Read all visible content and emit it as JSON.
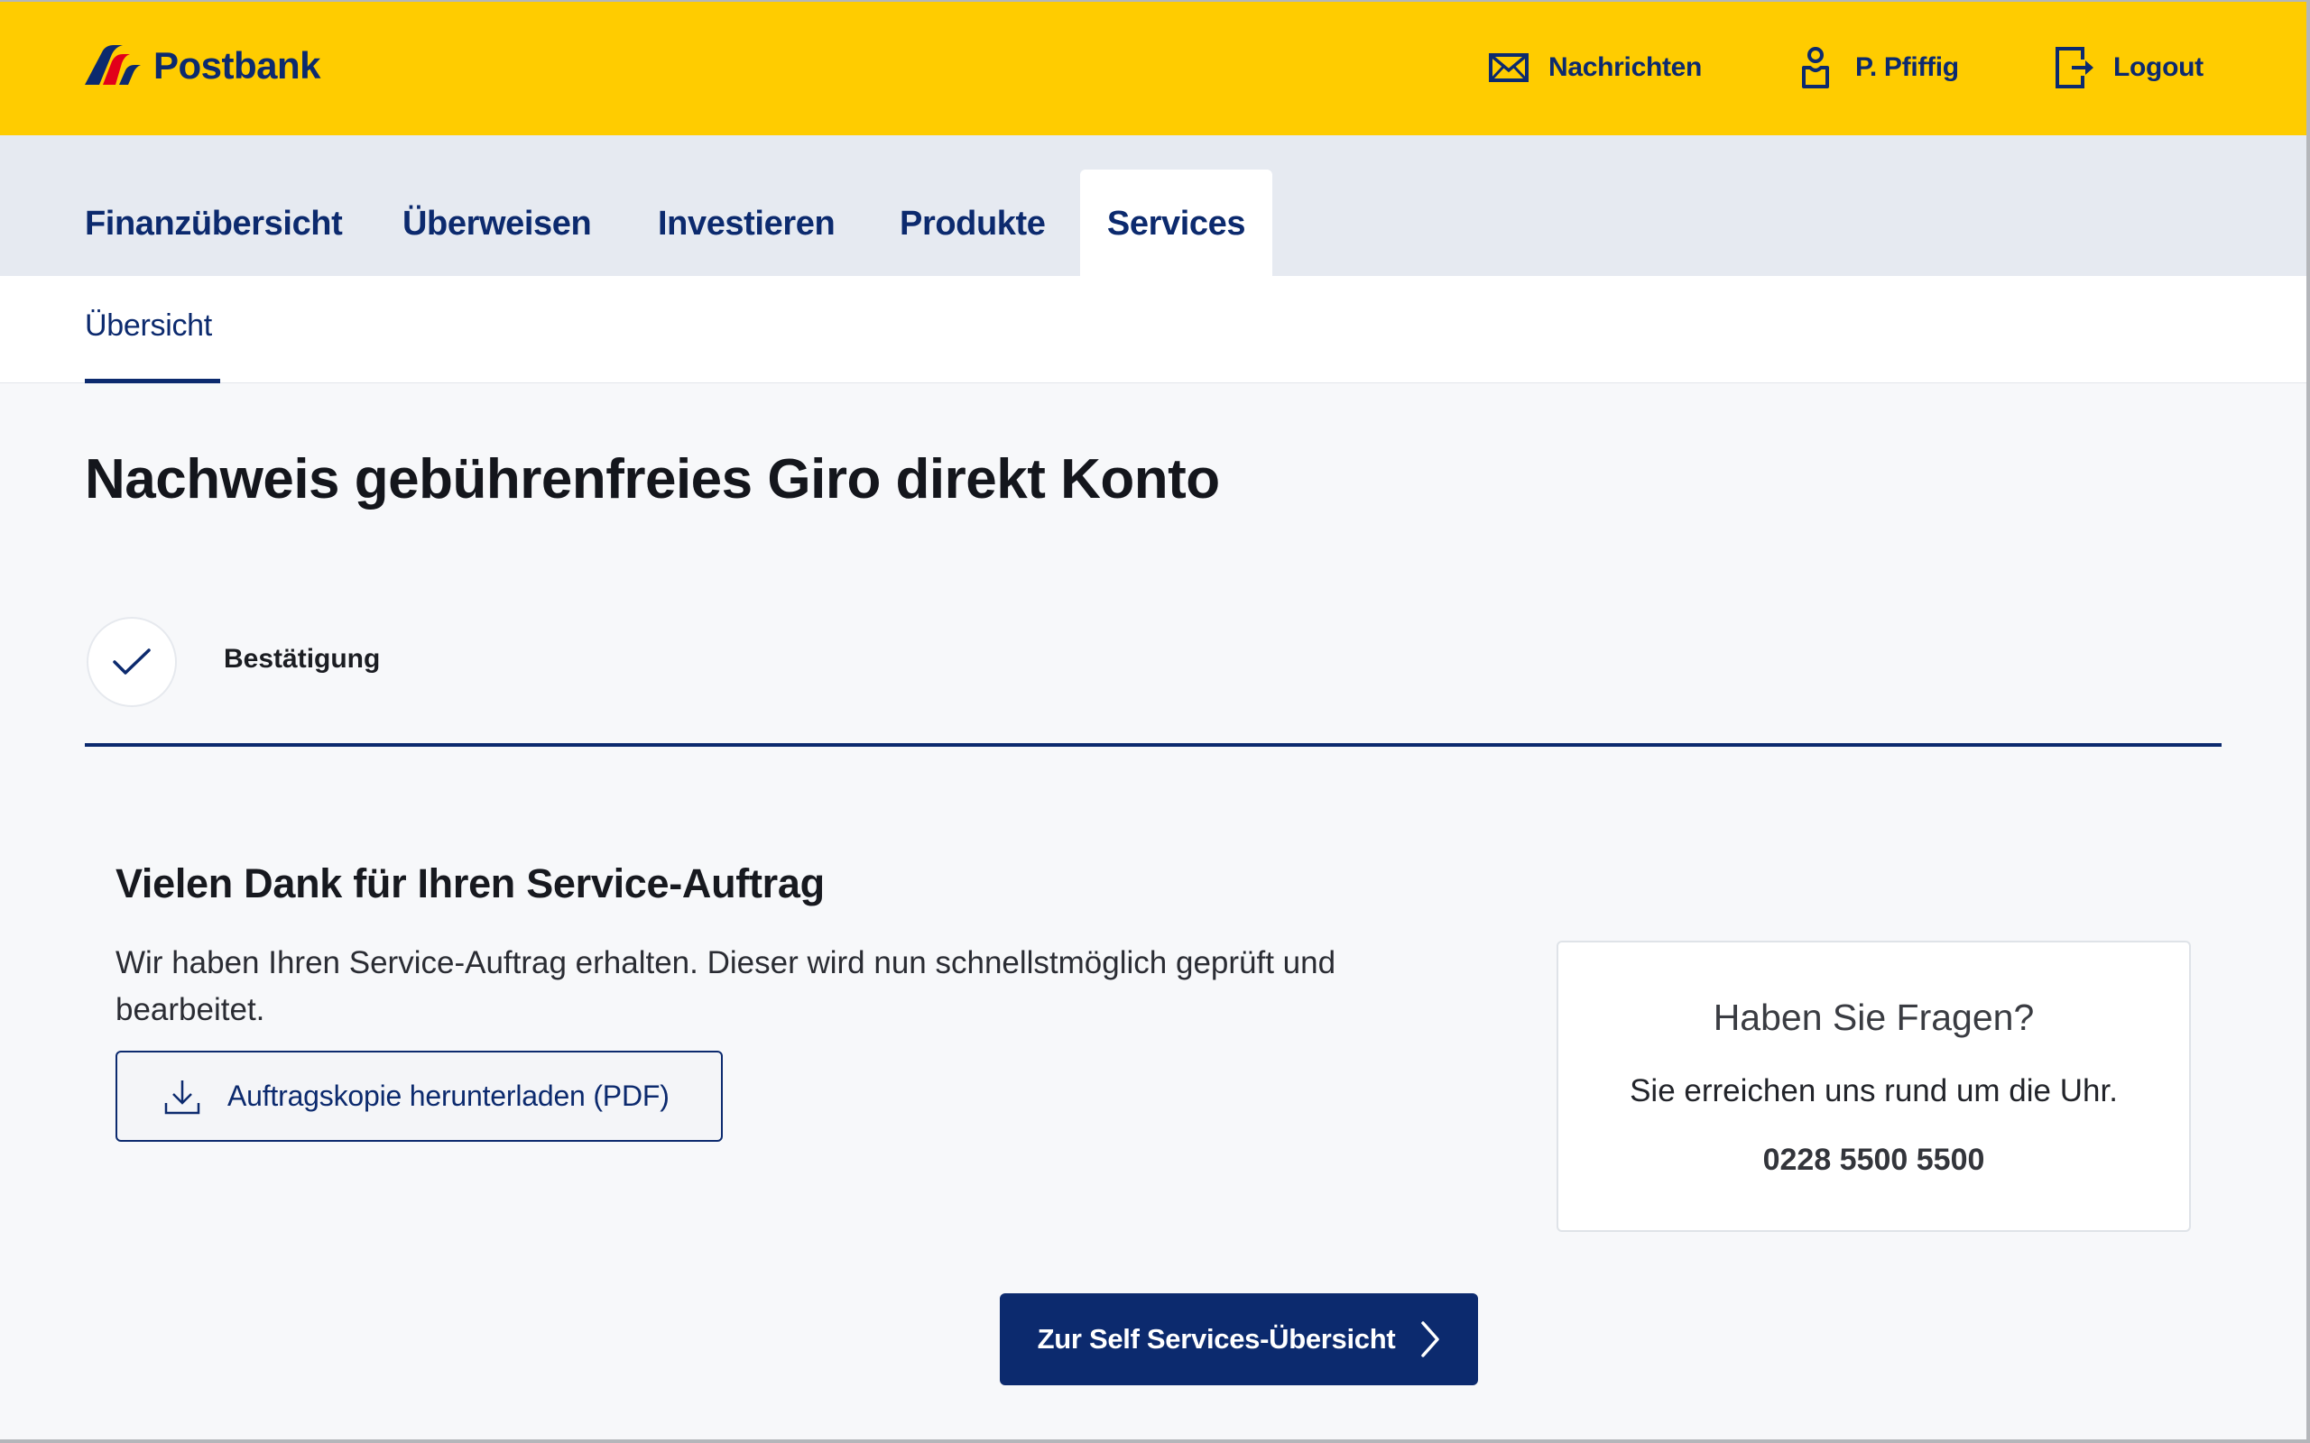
{
  "colors": {
    "brand_yellow": "#ffcc00",
    "brand_blue": "#0c2a6e",
    "logo_red": "#e2001a",
    "nav_background": "#e6eaf1",
    "page_background": "#f7f8fa"
  },
  "header": {
    "logo_text": "Postbank",
    "links": [
      {
        "label": "Nachrichten",
        "icon": "envelope-icon"
      },
      {
        "label": "P. Pfiffig",
        "icon": "user-icon"
      },
      {
        "label": "Logout",
        "icon": "logout-icon"
      }
    ]
  },
  "main_nav": {
    "tabs": [
      {
        "label": "Finanzübersicht",
        "active": false
      },
      {
        "label": "Überweisen",
        "active": false
      },
      {
        "label": "Investieren",
        "active": false
      },
      {
        "label": "Produkte",
        "active": false
      },
      {
        "label": "Services",
        "active": true
      }
    ]
  },
  "sub_nav": {
    "tabs": [
      {
        "label": "Übersicht",
        "active": true
      }
    ]
  },
  "page": {
    "title": "Nachweis gebührenfreies Giro direkt Konto",
    "step": {
      "label": "Bestätigung",
      "icon": "checkmark-icon",
      "completed": true
    }
  },
  "confirmation": {
    "title": "Vielen Dank für Ihren Service-Auftrag",
    "text": "Wir haben Ihren Service-Auftrag erhalten. Dieser wird nun schnellstmöglich geprüft und bearbeitet.",
    "download_button": {
      "label": "Auftragskopie herunterladen (PDF)",
      "icon": "download-icon"
    }
  },
  "help_card": {
    "title": "Haben Sie Fragen?",
    "text": "Sie erreichen uns rund um die Uhr.",
    "phone": "0228 5500 5500"
  },
  "primary_action": {
    "label": "Zur Self Services-Übersicht",
    "icon": "chevron-right-icon"
  }
}
